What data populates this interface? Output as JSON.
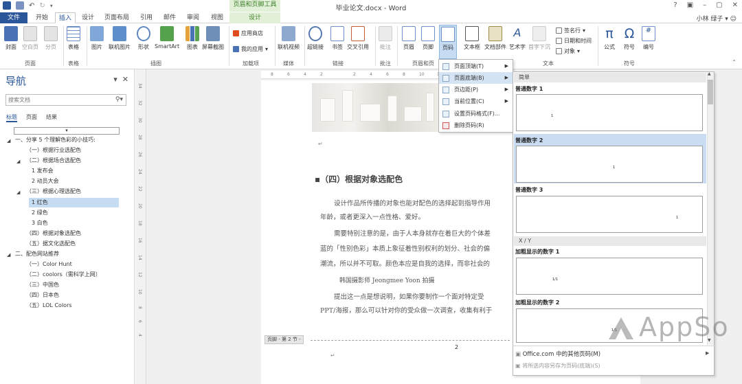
{
  "title_bar": {
    "document_title": "毕业论文.docx - Word",
    "contextual_tools_title": "页眉和页脚工具",
    "help": "?",
    "user_name": "小林 绿子"
  },
  "tabs": [
    "文件",
    "开始",
    "插入",
    "设计",
    "页面布局",
    "引用",
    "邮件",
    "审阅",
    "视图",
    "设计"
  ],
  "ribbon": {
    "buttons": {
      "cover": "封面",
      "blank_page": "空白页",
      "page_break": "分页",
      "table": "表格",
      "picture": "图片",
      "online_picture": "联机图片",
      "shapes": "形状",
      "smartart": "SmartArt",
      "chart": "图表",
      "screenshot": "屏幕截图",
      "app_store": "应用商店",
      "my_apps": "我的应用",
      "online_video": "联机视频",
      "hyperlink": "超链接",
      "bookmark": "书签",
      "cross_ref": "交叉引用",
      "comment": "批注",
      "header": "页眉",
      "footer": "页脚",
      "page_number": "页码",
      "textbox": "文本框",
      "quick_parts": "文档部件",
      "wordart": "艺术字",
      "drop_cap": "首字下沉",
      "signature": "签名行",
      "datetime": "日期和时间",
      "object": "对象",
      "equation": "公式",
      "symbol": "符号",
      "number": "编号"
    },
    "groups": {
      "pages": "页面",
      "tables": "表格",
      "illustrations": "插图",
      "addins": "加载项",
      "media": "媒体",
      "links": "链接",
      "comments": "批注",
      "header_footer": "页眉和页",
      "text": "文本",
      "symbols": "符号"
    }
  },
  "nav": {
    "title": "导航",
    "search_placeholder": "搜索文档",
    "tabs": [
      "标题",
      "页面",
      "结果"
    ],
    "items": [
      "一、分享 5 个理解色彩的小技巧:",
      "（一）根据行业选配色",
      "（二）根据场合选配色",
      "1 发布会",
      "2 动员大会",
      "（三）根据心理选配色",
      "1 红色",
      "2 绿色",
      "3 白色",
      "（四）根据对象选配色",
      "（五）据文化选配色",
      "二、配色网站推荐",
      "（一）Color Hunt",
      "（二）coolors（需科学上网）",
      "（三）中国色",
      "（四）日本色",
      "（五）LOL Colors"
    ]
  },
  "document": {
    "heading": "（四）根据对象选配色",
    "p1a": "设计作品所传播的对象也能对配色的选择起到指导作用",
    "p1b": "年龄，或者更深入一点性格、爱好。",
    "p2a": "需要特别注意的是，由于人本身就存在着巨大的个体差",
    "p2b": "蓝的「性别色彩」本质上象征着性别权利的划分、社会的偏",
    "p2c": "潮流，所以并不可取。颜色本应是自我的选择，而非社会的",
    "caption": "韩国摄影师 Jeongmee Yoon 拍摄",
    "p3a": "提出这一点是想说明，如果你要制作一个面对特定受",
    "p3b": "PPT/海报，那么可以针对你的受众做一次调查，收集有利于",
    "footer_tag": "页脚 - 第 2 节 -",
    "footer_page_number": "2"
  },
  "page_number_menu": {
    "items": [
      "页面顶端(T)",
      "页面底端(B)",
      "页边距(P)",
      "当前位置(C)",
      "设置页码格式(F)...",
      "删除页码(R)"
    ]
  },
  "gallery": {
    "section_simple": "简单",
    "section_xy": "X / Y",
    "items": [
      "普通数字 1",
      "普通数字 2",
      "普通数字 3",
      "加粗显示的数字 1",
      "加粗显示的数字 2"
    ],
    "preview_numbers": [
      "1",
      "1",
      "1",
      "1/1",
      "1/1"
    ],
    "more_link": "Office.com 中的其他页码(M)",
    "save_selection": "将所选内容另存为页码(底端)(S)"
  },
  "watermark": "AppSo",
  "colors": {
    "accent": "#2b579a",
    "contextual": "#3a7d26",
    "highlight": "#c9dcf2"
  }
}
